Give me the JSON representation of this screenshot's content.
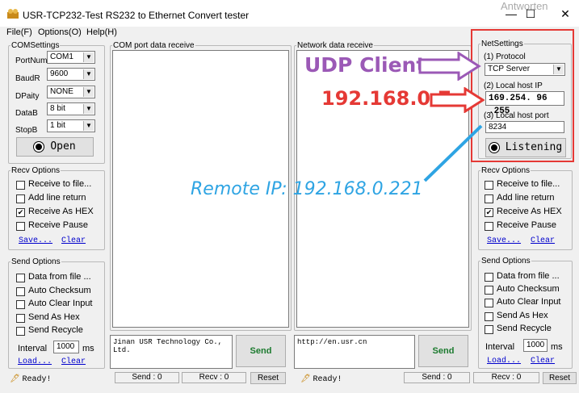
{
  "window": {
    "title": "USR-TCP232-Test  RS232 to Ethernet Convert tester",
    "minimize": "—",
    "maximize": "☐",
    "close": "✕",
    "bg_text": "Antworten"
  },
  "menu": [
    "File(F)",
    "Options(O)",
    "Help(H)"
  ],
  "com_settings": {
    "title": "COMSettings",
    "fields": [
      {
        "label": "PortNum",
        "value": "COM1"
      },
      {
        "label": "BaudR",
        "value": "9600"
      },
      {
        "label": "DPaity",
        "value": "NONE"
      },
      {
        "label": "DataB",
        "value": "8 bit"
      },
      {
        "label": "StopB",
        "value": "1 bit"
      }
    ],
    "open_label": "Open"
  },
  "com_receive": {
    "title": "COM port data receive"
  },
  "net_receive": {
    "title": "Network data receive"
  },
  "left_recv": {
    "title": "Recv Options",
    "items": [
      {
        "label": "Receive to file...",
        "checked": false
      },
      {
        "label": "Add line return",
        "checked": false
      },
      {
        "label": "Receive As HEX",
        "checked": true
      },
      {
        "label": "Receive Pause",
        "checked": false
      }
    ],
    "save": "Save...",
    "clear": "Clear"
  },
  "left_send": {
    "title": "Send Options",
    "items": [
      {
        "label": "Data from file ...",
        "checked": false
      },
      {
        "label": "Auto Checksum",
        "checked": false
      },
      {
        "label": "Auto Clear Input",
        "checked": false
      },
      {
        "label": "Send As Hex",
        "checked": false
      },
      {
        "label": "Send Recycle",
        "checked": false
      }
    ],
    "interval_label": "Interval",
    "interval_value": "1000",
    "unit": "ms",
    "load": "Load...",
    "clear": "Clear"
  },
  "net_settings": {
    "title": "NetSettings",
    "protocol_label": "(1) Protocol",
    "protocol_value": "TCP Server",
    "host_ip_label": "(2) Local host IP",
    "host_ip_value": "169.254. 96 .255",
    "port_label": "(3) Local host port",
    "port_value": "8234",
    "listen_label": "Listening"
  },
  "right_recv": {
    "title": "Recv Options",
    "items": [
      {
        "label": "Receive to file...",
        "checked": false
      },
      {
        "label": "Add line return",
        "checked": false
      },
      {
        "label": "Receive As HEX",
        "checked": true
      },
      {
        "label": "Receive Pause",
        "checked": false
      }
    ],
    "save": "Save...",
    "clear": "Clear"
  },
  "right_send": {
    "title": "Send Options",
    "items": [
      {
        "label": "Data from file ...",
        "checked": false
      },
      {
        "label": "Auto Checksum",
        "checked": false
      },
      {
        "label": "Auto Clear Input",
        "checked": false
      },
      {
        "label": "Send As Hex",
        "checked": false
      },
      {
        "label": "Send Recycle",
        "checked": false
      }
    ],
    "interval_label": "Interval",
    "interval_value": "1000",
    "unit": "ms",
    "load": "Load...",
    "clear": "Clear"
  },
  "com_send": {
    "text": "Jinan USR Technology Co., Ltd.",
    "button": "Send"
  },
  "net_send": {
    "text": "http://en.usr.cn",
    "button": "Send"
  },
  "status_left": {
    "ready": "Ready!",
    "send": "Send : 0",
    "recv": "Recv : 0",
    "reset": "Reset"
  },
  "status_right": {
    "ready": "Ready!",
    "send": "Send : 0",
    "recv": "Recv : 0",
    "reset": "Reset"
  },
  "annotations": {
    "udp_client": "UDP Client",
    "ip": "192.168.0.7",
    "remote_ip": "Remote IP: 192.168.0.221"
  },
  "colors": {
    "annotation_purple": "#9b59b6",
    "annotation_red": "#e53935",
    "annotation_blue": "#2ea4e3",
    "highlight_box": "#e53935"
  }
}
